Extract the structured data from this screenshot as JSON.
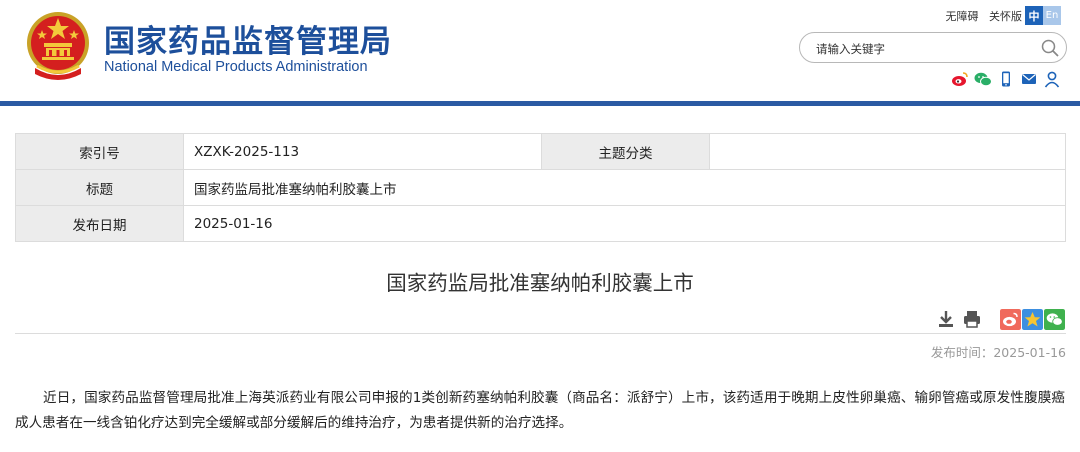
{
  "header": {
    "title_cn": "国家药品监督管理局",
    "title_en": "National Medical Products Administration",
    "links": [
      "无障碍",
      "关怀版"
    ],
    "lang": {
      "zh": "中",
      "en": "En"
    },
    "search": {
      "placeholder": "请输入关键字"
    },
    "social_icons": [
      "weibo-icon",
      "wechat-icon",
      "mobile-icon",
      "mail-icon",
      "user-icon"
    ],
    "colors": {
      "brand": "#1d4f9b",
      "rule": "#2b5aa3"
    }
  },
  "info": {
    "index_label": "索引号",
    "index_value": "XZXK-2025-113",
    "topic_label": "主题分类",
    "topic_value": "",
    "title_label": "标题",
    "title_value": "国家药监局批准塞纳帕利胶囊上市",
    "date_label": "发布日期",
    "date_value": "2025-01-16"
  },
  "article": {
    "title": "国家药监局批准塞纳帕利胶囊上市",
    "publish_time": "发布时间：2025-01-16",
    "tools": [
      "download-icon",
      "print-icon"
    ],
    "share": [
      "share-weibo-icon",
      "share-qzone-icon",
      "share-wechat-icon"
    ],
    "body": "近日，国家药品监督管理局批准上海英派药业有限公司申报的1类创新药塞纳帕利胶囊（商品名：派舒宁）上市，该药适用于晚期上皮性卵巢癌、输卵管癌或原发性腹膜癌成人患者在一线含铂化疗达到完全缓解或部分缓解后的维持治疗，为患者提供新的治疗选择。"
  }
}
